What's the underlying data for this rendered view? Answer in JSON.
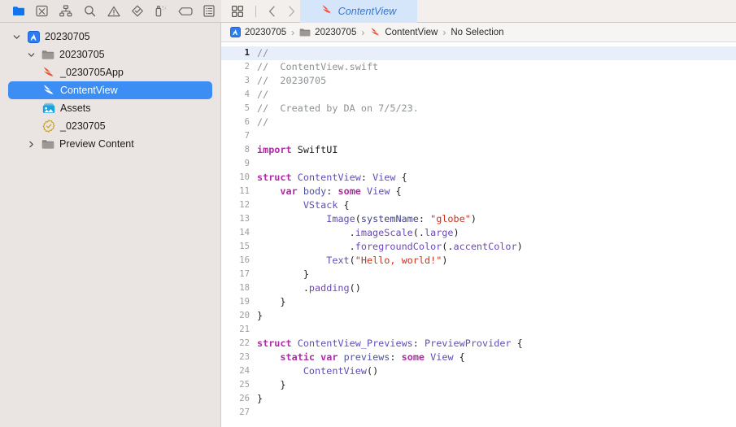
{
  "navigator_toolbar": {
    "icons": [
      {
        "name": "folder-icon",
        "title": "Project navigator",
        "active": true
      },
      {
        "name": "source-control-icon",
        "title": "Source control navigator",
        "active": false
      },
      {
        "name": "symbol-hierarchy-icon",
        "title": "Symbol navigator",
        "active": false
      },
      {
        "name": "search-icon",
        "title": "Find navigator",
        "active": false
      },
      {
        "name": "warning-triangle-icon",
        "title": "Issue navigator",
        "active": false
      },
      {
        "name": "diamond-test-icon",
        "title": "Test navigator",
        "active": false
      },
      {
        "name": "spray-can-debug-icon",
        "title": "Debug navigator",
        "active": false
      },
      {
        "name": "breakpoint-tag-icon",
        "title": "Breakpoint navigator",
        "active": false
      },
      {
        "name": "report-list-icon",
        "title": "Report navigator",
        "active": false
      }
    ]
  },
  "editor_toolbar": {
    "grid_button": "grid-view-icon",
    "back_button": "chevron-left-icon",
    "forward_button": "chevron-right-icon"
  },
  "tab": {
    "label": "ContentView",
    "icon": "swift-file-icon",
    "active": true
  },
  "sidebar": {
    "items": [
      {
        "label": "20230705",
        "icon": "xcode-project-icon",
        "indent": 0,
        "disclosure": "down",
        "selected": false
      },
      {
        "label": "20230705",
        "icon": "folder-gray-icon",
        "indent": 1,
        "disclosure": "down",
        "selected": false
      },
      {
        "label": "_0230705App",
        "icon": "swift-file-icon",
        "indent": 2,
        "disclosure": "none",
        "selected": false
      },
      {
        "label": "ContentView",
        "icon": "swift-file-white-icon",
        "indent": 2,
        "disclosure": "none",
        "selected": true
      },
      {
        "label": "Assets",
        "icon": "assets-catalog-icon",
        "indent": 2,
        "disclosure": "none",
        "selected": false
      },
      {
        "label": "_0230705",
        "icon": "entitlements-badge-icon",
        "indent": 2,
        "disclosure": "none",
        "selected": false
      },
      {
        "label": "Preview Content",
        "icon": "folder-gray-icon",
        "indent": 1,
        "disclosure": "right",
        "selected": false
      }
    ]
  },
  "breadcrumb": {
    "items": [
      {
        "label": "20230705",
        "icon": "xcode-project-icon"
      },
      {
        "label": "20230705",
        "icon": "folder-gray-icon"
      },
      {
        "label": "ContentView",
        "icon": "swift-file-icon"
      },
      {
        "label": "No Selection",
        "icon": "none"
      }
    ],
    "separator": "›"
  },
  "editor": {
    "language": "Swift",
    "current_line": 1,
    "total_lines": 27,
    "lines": [
      {
        "n": 1,
        "tokens": [
          {
            "t": "//",
            "c": "c-comment"
          }
        ]
      },
      {
        "n": 2,
        "tokens": [
          {
            "t": "//  ContentView.swift",
            "c": "c-comment"
          }
        ]
      },
      {
        "n": 3,
        "tokens": [
          {
            "t": "//  20230705",
            "c": "c-comment"
          }
        ]
      },
      {
        "n": 4,
        "tokens": [
          {
            "t": "//",
            "c": "c-comment"
          }
        ]
      },
      {
        "n": 5,
        "tokens": [
          {
            "t": "//  Created by DA on 7/5/23.",
            "c": "c-comment"
          }
        ]
      },
      {
        "n": 6,
        "tokens": [
          {
            "t": "//",
            "c": "c-comment"
          }
        ]
      },
      {
        "n": 7,
        "tokens": []
      },
      {
        "n": 8,
        "tokens": [
          {
            "t": "import",
            "c": "c-keyword"
          },
          {
            "t": " SwiftUI",
            "c": "c-plain"
          }
        ]
      },
      {
        "n": 9,
        "tokens": []
      },
      {
        "n": 10,
        "tokens": [
          {
            "t": "struct",
            "c": "c-keyword"
          },
          {
            "t": " ",
            "c": "c-plain"
          },
          {
            "t": "ContentView",
            "c": "c-type"
          },
          {
            "t": ": ",
            "c": "c-plain"
          },
          {
            "t": "View",
            "c": "c-type"
          },
          {
            "t": " {",
            "c": "c-plain"
          }
        ]
      },
      {
        "n": 11,
        "tokens": [
          {
            "t": "    ",
            "c": "c-plain"
          },
          {
            "t": "var",
            "c": "c-keyword"
          },
          {
            "t": " ",
            "c": "c-plain"
          },
          {
            "t": "body",
            "c": "c-method"
          },
          {
            "t": ": ",
            "c": "c-plain"
          },
          {
            "t": "some",
            "c": "c-keyword"
          },
          {
            "t": " ",
            "c": "c-plain"
          },
          {
            "t": "View",
            "c": "c-type"
          },
          {
            "t": " {",
            "c": "c-plain"
          }
        ]
      },
      {
        "n": 12,
        "tokens": [
          {
            "t": "        ",
            "c": "c-plain"
          },
          {
            "t": "VStack",
            "c": "c-type"
          },
          {
            "t": " {",
            "c": "c-plain"
          }
        ]
      },
      {
        "n": 13,
        "tokens": [
          {
            "t": "            ",
            "c": "c-plain"
          },
          {
            "t": "Image",
            "c": "c-type"
          },
          {
            "t": "(",
            "c": "c-plain"
          },
          {
            "t": "systemName",
            "c": "c-param"
          },
          {
            "t": ": ",
            "c": "c-plain"
          },
          {
            "t": "\"globe\"",
            "c": "c-string"
          },
          {
            "t": ")",
            "c": "c-plain"
          }
        ]
      },
      {
        "n": 14,
        "tokens": [
          {
            "t": "                .",
            "c": "c-plain"
          },
          {
            "t": "imageScale",
            "c": "c-member"
          },
          {
            "t": "(.",
            "c": "c-plain"
          },
          {
            "t": "large",
            "c": "c-member"
          },
          {
            "t": ")",
            "c": "c-plain"
          }
        ]
      },
      {
        "n": 15,
        "tokens": [
          {
            "t": "                .",
            "c": "c-plain"
          },
          {
            "t": "foregroundColor",
            "c": "c-member"
          },
          {
            "t": "(.",
            "c": "c-plain"
          },
          {
            "t": "accentColor",
            "c": "c-member"
          },
          {
            "t": ")",
            "c": "c-plain"
          }
        ]
      },
      {
        "n": 16,
        "tokens": [
          {
            "t": "            ",
            "c": "c-plain"
          },
          {
            "t": "Text",
            "c": "c-type"
          },
          {
            "t": "(",
            "c": "c-plain"
          },
          {
            "t": "\"Hello, world!\"",
            "c": "c-string"
          },
          {
            "t": ")",
            "c": "c-plain"
          }
        ]
      },
      {
        "n": 17,
        "tokens": [
          {
            "t": "        }",
            "c": "c-plain"
          }
        ]
      },
      {
        "n": 18,
        "tokens": [
          {
            "t": "        .",
            "c": "c-plain"
          },
          {
            "t": "padding",
            "c": "c-member"
          },
          {
            "t": "()",
            "c": "c-plain"
          }
        ]
      },
      {
        "n": 19,
        "tokens": [
          {
            "t": "    }",
            "c": "c-plain"
          }
        ]
      },
      {
        "n": 20,
        "tokens": [
          {
            "t": "}",
            "c": "c-plain"
          }
        ]
      },
      {
        "n": 21,
        "tokens": []
      },
      {
        "n": 22,
        "tokens": [
          {
            "t": "struct",
            "c": "c-keyword"
          },
          {
            "t": " ",
            "c": "c-plain"
          },
          {
            "t": "ContentView_Previews",
            "c": "c-type"
          },
          {
            "t": ": ",
            "c": "c-plain"
          },
          {
            "t": "PreviewProvider",
            "c": "c-type"
          },
          {
            "t": " {",
            "c": "c-plain"
          }
        ]
      },
      {
        "n": 23,
        "tokens": [
          {
            "t": "    ",
            "c": "c-plain"
          },
          {
            "t": "static",
            "c": "c-keyword"
          },
          {
            "t": " ",
            "c": "c-plain"
          },
          {
            "t": "var",
            "c": "c-keyword"
          },
          {
            "t": " ",
            "c": "c-plain"
          },
          {
            "t": "previews",
            "c": "c-method"
          },
          {
            "t": ": ",
            "c": "c-plain"
          },
          {
            "t": "some",
            "c": "c-keyword"
          },
          {
            "t": " ",
            "c": "c-plain"
          },
          {
            "t": "View",
            "c": "c-type"
          },
          {
            "t": " {",
            "c": "c-plain"
          }
        ]
      },
      {
        "n": 24,
        "tokens": [
          {
            "t": "        ",
            "c": "c-plain"
          },
          {
            "t": "ContentView",
            "c": "c-type"
          },
          {
            "t": "()",
            "c": "c-plain"
          }
        ]
      },
      {
        "n": 25,
        "tokens": [
          {
            "t": "    }",
            "c": "c-plain"
          }
        ]
      },
      {
        "n": 26,
        "tokens": [
          {
            "t": "}",
            "c": "c-plain"
          }
        ]
      },
      {
        "n": 27,
        "tokens": []
      }
    ]
  },
  "colors": {
    "sidebar_bg": "#eae5e2",
    "toolbar_bg": "#e9e4e1",
    "selection_blue": "#3d8ef4",
    "tab_active_bg": "#d5e6fb",
    "tab_label_blue": "#2d76d8",
    "current_line_bg": "#e9eefb",
    "swift_orange": "#f05138",
    "editor_bg": "#ffffff"
  }
}
